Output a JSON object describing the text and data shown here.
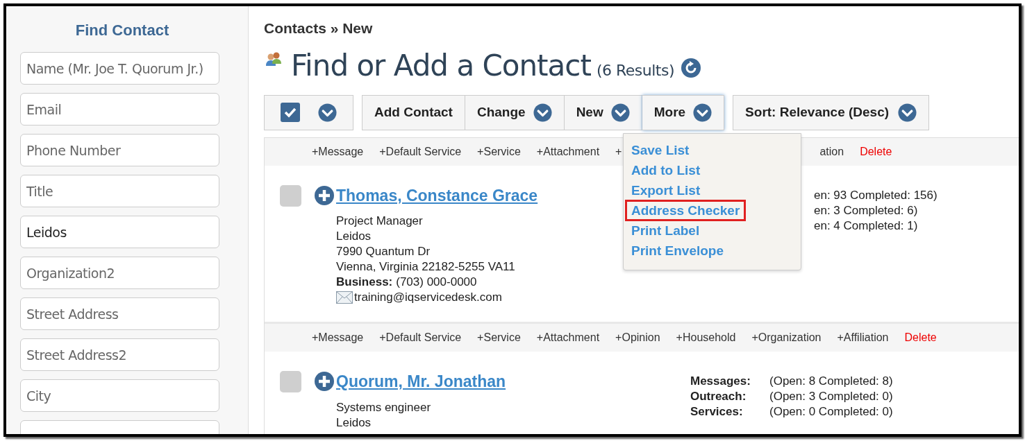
{
  "sidebar": {
    "title": "Find Contact",
    "fields": [
      {
        "placeholder": "Name (Mr. Joe T. Quorum Jr.)"
      },
      {
        "placeholder": "Email"
      },
      {
        "placeholder": "Phone Number"
      },
      {
        "placeholder": "Title"
      },
      {
        "value": "Leidos"
      },
      {
        "placeholder": "Organization2"
      },
      {
        "placeholder": "Street Address"
      },
      {
        "placeholder": "Street Address2"
      },
      {
        "placeholder": "City"
      }
    ]
  },
  "breadcrumb": "Contacts » New",
  "heading": {
    "title": "Find or Add a Contact",
    "count": "(6 Results)"
  },
  "toolbar": {
    "select_all": {
      "checked": true
    },
    "buttons": [
      {
        "label": "Add Contact",
        "dropdown": false,
        "expanded": false
      },
      {
        "label": "Change",
        "dropdown": true,
        "expanded": false
      },
      {
        "label": "New",
        "dropdown": true,
        "expanded": false
      },
      {
        "label": "More",
        "dropdown": true,
        "expanded": true
      }
    ],
    "sort": "Sort: Relevance (Desc)"
  },
  "more_menu": [
    {
      "label": "Save List",
      "highlighted": false
    },
    {
      "label": "Add to List",
      "highlighted": false
    },
    {
      "label": "Export List",
      "highlighted": false
    },
    {
      "label": "Address Checker",
      "highlighted": true
    },
    {
      "label": "Print Label",
      "highlighted": false
    },
    {
      "label": "Print Envelope",
      "highlighted": false
    }
  ],
  "contacts": [
    {
      "actions_left": [
        "+Message",
        "+Default Service",
        "+Service",
        "+Attachment",
        "+"
      ],
      "actions_right": [
        "ation"
      ],
      "delete": "Delete",
      "checked": false,
      "name": "Thomas, Constance Grace",
      "lines": [
        "Project Manager",
        "Leidos",
        "7990 Quantum Dr",
        "Vienna, Virginia 22182-5255 VA11"
      ],
      "phone_label": "Business:",
      "phone": "(703) 000-0000",
      "email": "training@iqservicedesk.com",
      "stats": [
        {
          "value": "en: 93 Completed: 156)"
        },
        {
          "value": "en: 3 Completed: 6)"
        },
        {
          "value": "en: 4 Completed: 1)"
        }
      ]
    },
    {
      "actions_left": [
        "+Message",
        "+Default Service",
        "+Service",
        "+Attachment",
        "+Opinion",
        "+Household",
        "+Organization",
        "+Affiliation"
      ],
      "delete": "Delete",
      "checked": false,
      "name": "Quorum, Mr. Jonathan",
      "lines": [
        "Systems engineer",
        "Leidos"
      ],
      "stats": [
        {
          "label": "Messages:",
          "value": "(Open: 8 Completed: 8)"
        },
        {
          "label": "Outreach:",
          "value": "(Open: 3 Completed: 0)"
        },
        {
          "label": "Services:",
          "value": "(Open: 0 Completed: 0)"
        }
      ]
    }
  ]
}
